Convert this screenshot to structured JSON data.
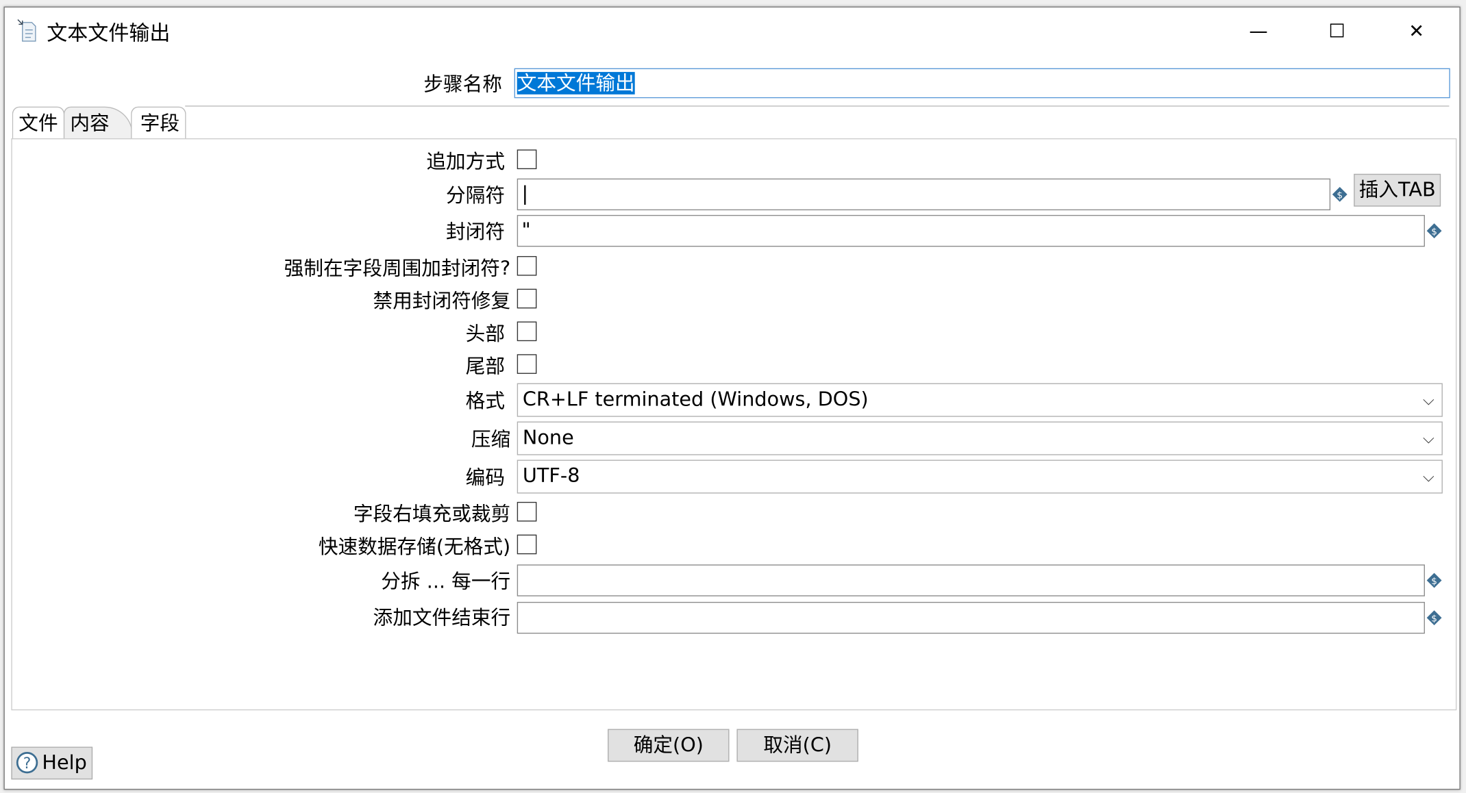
{
  "window": {
    "title": "文本文件输出",
    "icon": "text-file-output-icon",
    "controls": {
      "minimize": "—",
      "maximize": "☐",
      "close": "✕"
    }
  },
  "step_name": {
    "label": "步骤名称",
    "value": "文本文件输出"
  },
  "tabs": [
    {
      "label": "文件"
    },
    {
      "label": "内容",
      "active": true
    },
    {
      "label": "字段"
    }
  ],
  "content": {
    "append": {
      "label": "追加方式",
      "checked": false
    },
    "separator": {
      "label": "分隔符",
      "value": "|",
      "insert_tab": "插入TAB"
    },
    "enclosure": {
      "label": "封闭符",
      "value": "\""
    },
    "force_enclosure": {
      "label": "强制在字段周围加封闭符?",
      "checked": false
    },
    "disable_enclosure_fix": {
      "label": "禁用封闭符修复",
      "checked": false
    },
    "header": {
      "label": "头部",
      "checked": false
    },
    "footer": {
      "label": "尾部",
      "checked": false
    },
    "format": {
      "label": "格式",
      "value": "CR+LF terminated (Windows, DOS)"
    },
    "compression": {
      "label": "压缩",
      "value": "None"
    },
    "encoding": {
      "label": "编码",
      "value": "UTF-8"
    },
    "pad_fields": {
      "label": "字段右填充或裁剪",
      "checked": false
    },
    "fast_dump": {
      "label": "快速数据存储(无格式)",
      "checked": false
    },
    "split_every": {
      "label": "分拆 ... 每一行",
      "value": ""
    },
    "end_line": {
      "label": "添加文件结束行",
      "value": ""
    }
  },
  "footer": {
    "ok": "确定(O)",
    "cancel": "取消(C)",
    "help": "Help"
  },
  "colors": {
    "selection": "#0078d7",
    "variable_icon": "#3d6e92"
  }
}
